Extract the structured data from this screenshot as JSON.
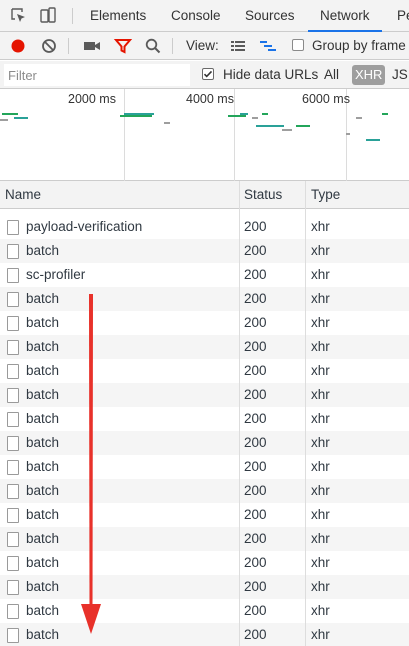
{
  "tabbar": {
    "icons": [
      "inspect-element-icon",
      "device-toolbar-icon"
    ],
    "tabs": [
      "Elements",
      "Console",
      "Sources",
      "Network",
      "Pe"
    ],
    "active_tab": "Network"
  },
  "toolbar": {
    "icons": [
      "record-icon",
      "clear-icon",
      "capture-screenshots-icon",
      "filter-icon",
      "search-icon"
    ],
    "view_label": "View:",
    "view_icons": [
      "large-rows-icon",
      "waterfall-icon"
    ],
    "group_by_frame_label": "Group by frame",
    "group_by_frame_checked": false
  },
  "filterbar": {
    "filter_placeholder": "Filter",
    "hide_data_urls_label": "Hide data URLs",
    "hide_data_urls_checked": true,
    "type_filters": [
      "All",
      "XHR",
      "JS"
    ],
    "active_type_filter": "XHR"
  },
  "overview": {
    "time_labels": [
      "2000 ms",
      "4000 ms",
      "6000 ms"
    ]
  },
  "table": {
    "columns": [
      "Name",
      "Status",
      "Type"
    ],
    "rows": [
      {
        "name": "payload-verification",
        "status": "200",
        "type": "xhr"
      },
      {
        "name": "batch",
        "status": "200",
        "type": "xhr"
      },
      {
        "name": "sc-profiler",
        "status": "200",
        "type": "xhr"
      },
      {
        "name": "batch",
        "status": "200",
        "type": "xhr"
      },
      {
        "name": "batch",
        "status": "200",
        "type": "xhr"
      },
      {
        "name": "batch",
        "status": "200",
        "type": "xhr"
      },
      {
        "name": "batch",
        "status": "200",
        "type": "xhr"
      },
      {
        "name": "batch",
        "status": "200",
        "type": "xhr"
      },
      {
        "name": "batch",
        "status": "200",
        "type": "xhr"
      },
      {
        "name": "batch",
        "status": "200",
        "type": "xhr"
      },
      {
        "name": "batch",
        "status": "200",
        "type": "xhr"
      },
      {
        "name": "batch",
        "status": "200",
        "type": "xhr"
      },
      {
        "name": "batch",
        "status": "200",
        "type": "xhr"
      },
      {
        "name": "batch",
        "status": "200",
        "type": "xhr"
      },
      {
        "name": "batch",
        "status": "200",
        "type": "xhr"
      },
      {
        "name": "batch",
        "status": "200",
        "type": "xhr"
      },
      {
        "name": "batch",
        "status": "200",
        "type": "xhr"
      },
      {
        "name": "batch",
        "status": "200",
        "type": "xhr"
      }
    ]
  },
  "colors": {
    "record": "#e51400",
    "filter_icon": "#e51400",
    "active_tab_underline": "#1a73e8",
    "overview_green": "#23a55a",
    "overview_teal": "#2aa198",
    "overview_gray": "#9e9e9e",
    "annotation_arrow": "#e8312a",
    "xhr_chip_bg": "#9e9e9e"
  },
  "annotation": {
    "icon": "red-down-arrow-icon"
  }
}
